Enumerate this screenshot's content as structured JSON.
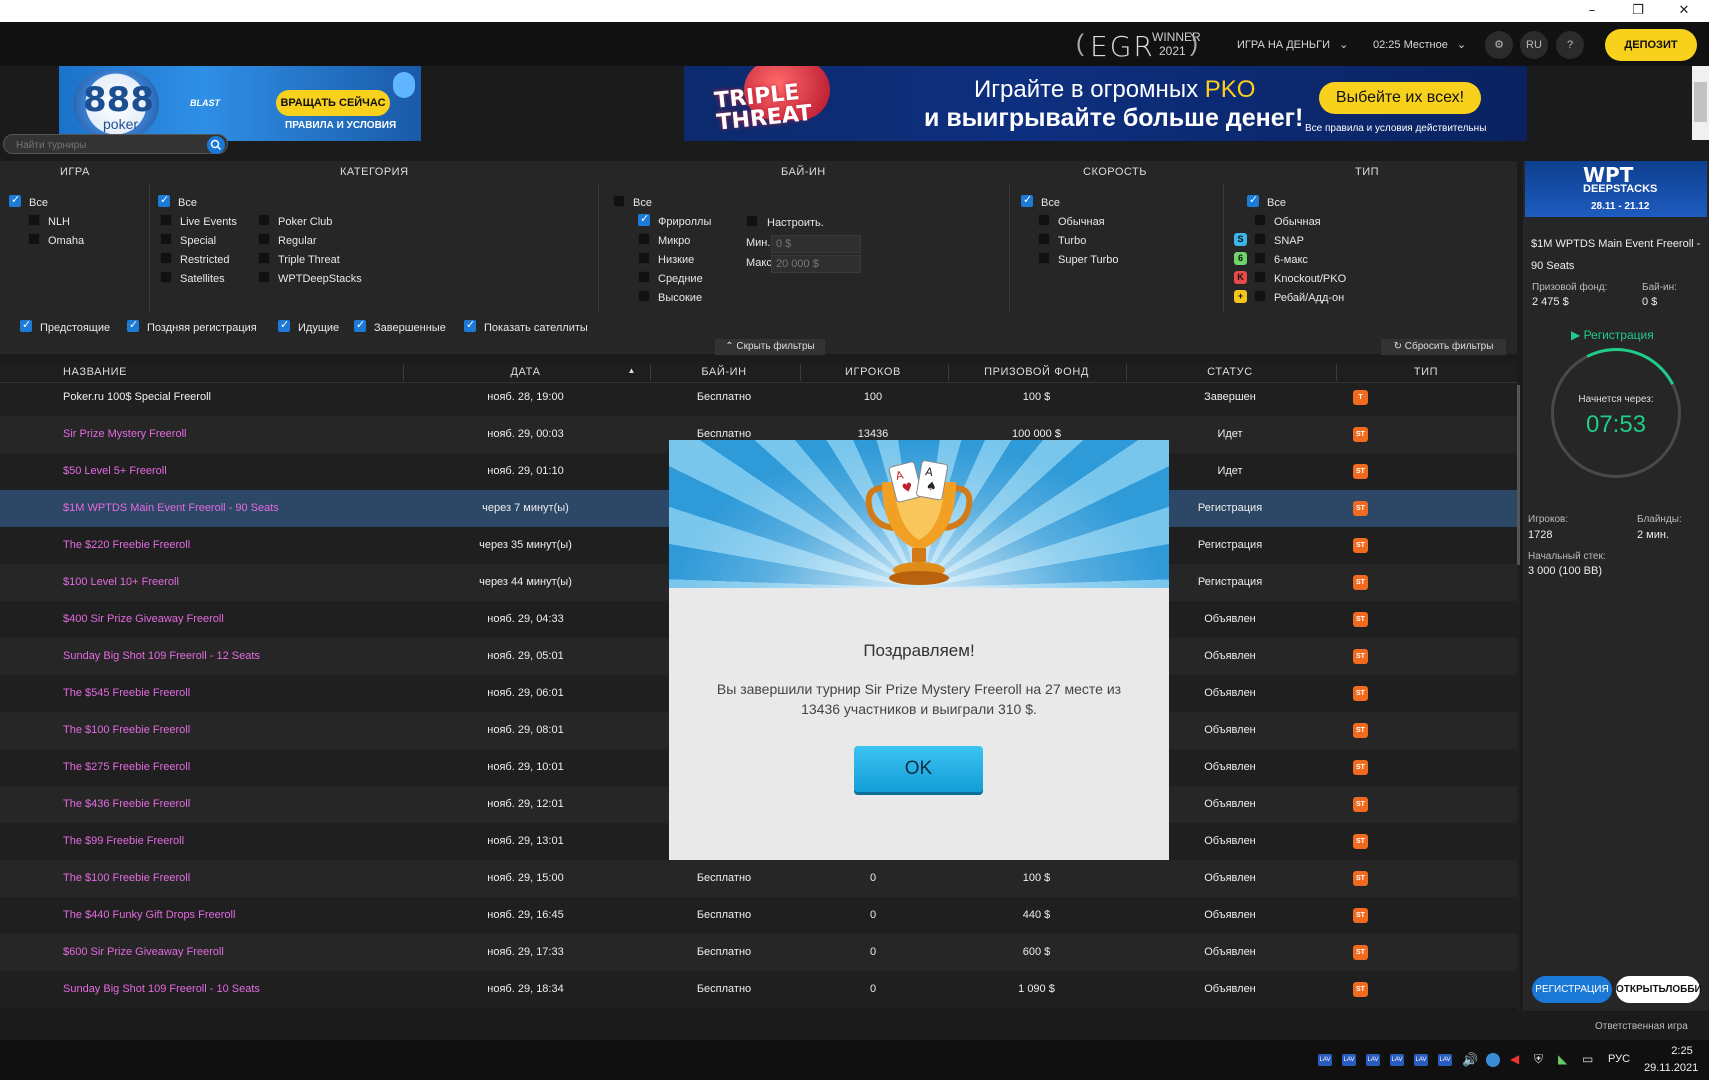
{
  "window": {
    "controls": [
      "–",
      "❐",
      "✕"
    ]
  },
  "topbar": {
    "egr_text": "EGR",
    "egr_winner": "WINNER",
    "egr_year": "2021",
    "real_money_menu": "ИГРА НА ДЕНЬГИ",
    "clock_menu": "02:25 Местное",
    "lang": "RU",
    "help": "?",
    "deposit_label": "ДЕПОЗИТ"
  },
  "banner_888": {
    "logo_number": "888",
    "logo_word": "poker",
    "blast": "BLAST",
    "spin_label": "ВРАЩАТЬ СЕЙЧАС",
    "rules_label": "ПРАВИЛА И УСЛОВИЯ"
  },
  "banner_pko": {
    "logo_line1": "TRIPLE",
    "logo_line2": "THREAT",
    "headline_part1": "Играйте в огромных ",
    "headline_accent": "PKO",
    "headline_line2": "и выигрывайте больше денег!",
    "cta_label": "Выбейте их всех!",
    "note": "Все правила и условия действительны"
  },
  "search": {
    "placeholder": "Найти турниры"
  },
  "filters": {
    "headers": {
      "game": "ИГРА",
      "category": "КАТЕГОРИЯ",
      "buyin": "БАЙ-ИН",
      "speed": "СКОРОСТЬ",
      "type": "ТИП"
    },
    "game": [
      "Все",
      "NLH",
      "Omaha"
    ],
    "category_col1": [
      "Все",
      "Live Events",
      "Special",
      "Restricted",
      "Satellites"
    ],
    "category_col2": [
      "Poker Club",
      "Regular",
      "Triple Threat",
      "WPTDeepStacks"
    ],
    "buyin": [
      "Все",
      "Фрироллы",
      "Микро",
      "Низкие",
      "Средние",
      "Высокие"
    ],
    "buyin_custom": "Настроить.",
    "min_label": "Мин.",
    "min_value": "0 $",
    "max_label": "Макс.",
    "max_value": "20 000 $",
    "speed": [
      "Все",
      "Обычная",
      "Turbo",
      "Super Turbo"
    ],
    "type": [
      "Все",
      "Обычная",
      "SNAP",
      "6-макс",
      "Knockout/PKO",
      "Ребай/Адд-он"
    ],
    "status": [
      "Предстоящие",
      "Поздняя регистрация",
      "Идущие",
      "Завершенные",
      "Показать сателлиты"
    ],
    "hide_label": "Скрыть фильтры",
    "reset_label": "Сбросить фильтры"
  },
  "table": {
    "columns": [
      "НАЗВАНИЕ",
      "ДАТА",
      "БАЙ-ИН",
      "ИГРОКОВ",
      "ПРИЗОВОЙ ФОНД",
      "СТАТУС",
      "ТИП"
    ],
    "rows": [
      {
        "name": "Poker.ru 100$ Special Freeroll",
        "date": "нояб. 28, 19:00",
        "buyin": "Бесплатно",
        "players": "100",
        "prize": "100 $",
        "status": "Завершен",
        "type": "T"
      },
      {
        "name": "Sir Prize Mystery Freeroll",
        "date": "нояб. 29, 00:03",
        "buyin": "Бесплатно",
        "players": "13436",
        "prize": "100 000 $",
        "status": "Идет",
        "type": "ST"
      },
      {
        "name": "$50 Level 5+ Freeroll",
        "date": "нояб. 29, 01:10",
        "buyin": "",
        "players": "",
        "prize": "",
        "status": "Идет",
        "type": "ST"
      },
      {
        "name": "$1M WPTDS Main Event Freeroll - 90 Seats",
        "date": "через 7 минут(ы)",
        "buyin": "",
        "players": "",
        "prize": "",
        "status": "Регистрация",
        "type": "ST"
      },
      {
        "name": "The $220 Freebie Freeroll",
        "date": "через 35 минут(ы)",
        "buyin": "",
        "players": "",
        "prize": "",
        "status": "Регистрация",
        "type": "ST"
      },
      {
        "name": "$100 Level 10+ Freeroll",
        "date": "через 44 минут(ы)",
        "buyin": "",
        "players": "",
        "prize": "",
        "status": "Регистрация",
        "type": "ST"
      },
      {
        "name": "$400 Sir Prize Giveaway Freeroll",
        "date": "нояб. 29, 04:33",
        "buyin": "",
        "players": "",
        "prize": "",
        "status": "Объявлен",
        "type": "ST"
      },
      {
        "name": "Sunday Big Shot 109 Freeroll - 12 Seats",
        "date": "нояб. 29, 05:01",
        "buyin": "",
        "players": "",
        "prize": "",
        "status": "Объявлен",
        "type": "ST"
      },
      {
        "name": "The $545 Freebie Freeroll",
        "date": "нояб. 29, 06:01",
        "buyin": "",
        "players": "",
        "prize": "",
        "status": "Объявлен",
        "type": "ST"
      },
      {
        "name": "The $100 Freebie Freeroll",
        "date": "нояб. 29, 08:01",
        "buyin": "",
        "players": "",
        "prize": "",
        "status": "Объявлен",
        "type": "ST"
      },
      {
        "name": "The $275 Freebie Freeroll",
        "date": "нояб. 29, 10:01",
        "buyin": "",
        "players": "",
        "prize": "",
        "status": "Объявлен",
        "type": "ST"
      },
      {
        "name": "The $436 Freebie Freeroll",
        "date": "нояб. 29, 12:01",
        "buyin": "",
        "players": "",
        "prize": "",
        "status": "Объявлен",
        "type": "ST"
      },
      {
        "name": "The $99 Freebie Freeroll",
        "date": "нояб. 29, 13:01",
        "buyin": "",
        "players": "",
        "prize": "",
        "status": "Объявлен",
        "type": "ST"
      },
      {
        "name": "The $100 Freebie Freeroll",
        "date": "нояб. 29, 15:00",
        "buyin": "Бесплатно",
        "players": "0",
        "prize": "100 $",
        "status": "Объявлен",
        "type": "ST"
      },
      {
        "name": "The $440 Funky Gift Drops Freeroll",
        "date": "нояб. 29, 16:45",
        "buyin": "Бесплатно",
        "players": "0",
        "prize": "440 $",
        "status": "Объявлен",
        "type": "ST"
      },
      {
        "name": "$600 Sir Prize Giveaway Freeroll",
        "date": "нояб. 29, 17:33",
        "buyin": "Бесплатно",
        "players": "0",
        "prize": "600 $",
        "status": "Объявлен",
        "type": "ST"
      },
      {
        "name": "Sunday Big Shot 109 Freeroll - 10 Seats",
        "date": "нояб. 29, 18:34",
        "buyin": "Бесплатно",
        "players": "0",
        "prize": "1 090 $",
        "status": "Объявлен",
        "type": "ST"
      }
    ]
  },
  "right_panel": {
    "wpt_logo": "WPT",
    "wpt_sub": "DEEPSTACKS",
    "wpt_dates": "28.11 - 21.12",
    "title_line1": "$1M WPTDS Main Event Freeroll -",
    "title_line2": "90 Seats",
    "prize_label": "Призовой фонд:",
    "prize_value": "2 475 $",
    "buyin_label": "Бай-ин:",
    "buyin_value": "0 $",
    "reg_label": "Регистрация",
    "starts_label": "Начнется через:",
    "timer": "07:53",
    "players_label": "Игроков:",
    "players_value": "1728",
    "blinds_label": "Блайнды:",
    "blinds_value": "2 мин.",
    "stack_label": "Начальный стек:",
    "stack_value": "3 000 (100 BB)",
    "register_btn": "РЕГИСТРАЦИЯ",
    "lobby_btn": "ОТКРЫТЬЛОББИ"
  },
  "footer": {
    "responsible": "Ответственная игра"
  },
  "taskbar": {
    "lang": "РУС",
    "time": "2:25",
    "date": "29.11.2021"
  },
  "modal": {
    "title": "Поздравляем!",
    "text": "Вы завершили турнир Sir Prize Mystery Freeroll на 27 месте из 13436 участников и выиграли 310 $.",
    "ok_label": "OK"
  },
  "colors": {
    "accent_yellow": "#f7d11c",
    "link_pink": "#e46ae0",
    "green": "#1fcc8a",
    "blue": "#1a78d6",
    "type_orange": "#f06a1f"
  }
}
